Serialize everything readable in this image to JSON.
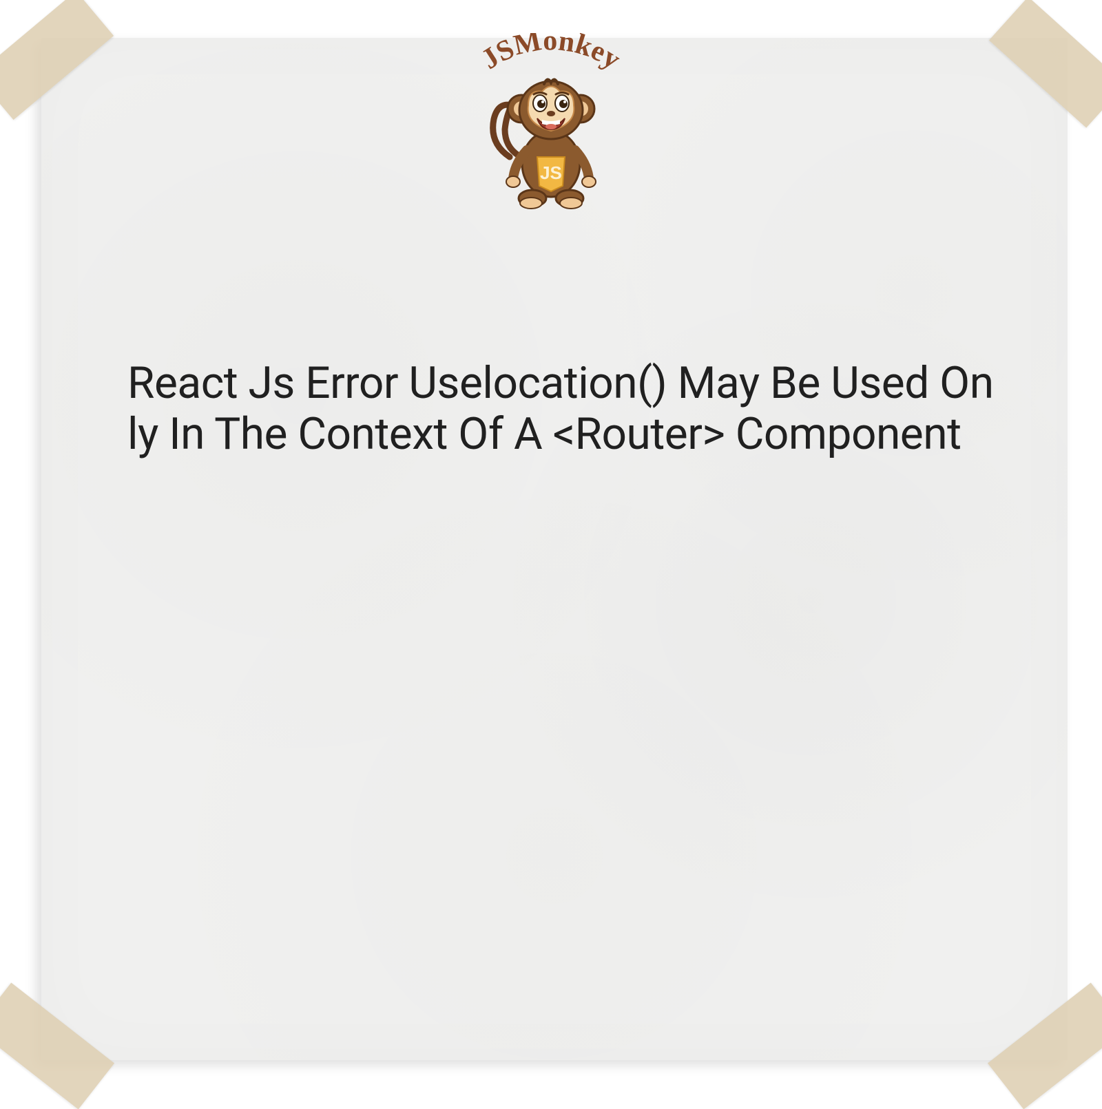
{
  "logo": {
    "brand_text": "JSMonkey",
    "badge_text": "JS"
  },
  "main": {
    "title": "React Js Error Uselocation() May Be Used Only In The Context Of A <Router> Component"
  },
  "colors": {
    "paper": "#f0f0ef",
    "tape": "#decfb2e8",
    "text": "#202020",
    "brand": "#8b4a28"
  }
}
